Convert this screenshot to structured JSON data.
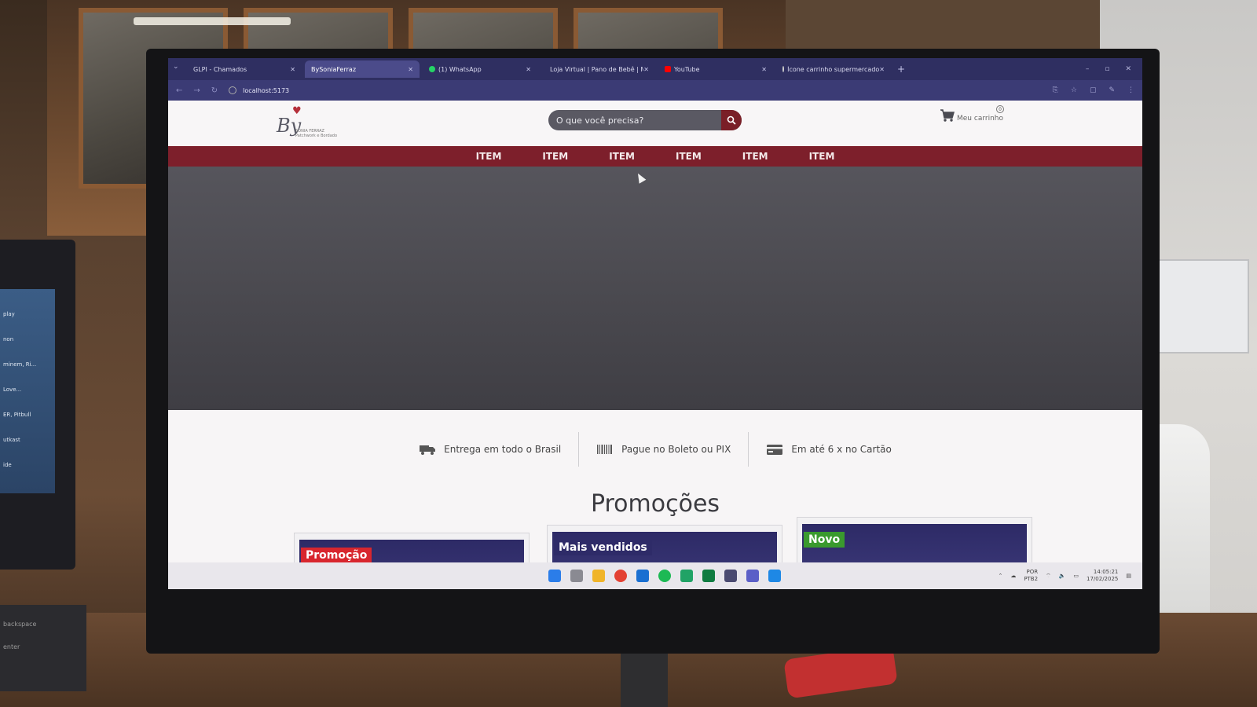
{
  "browser": {
    "tabs": [
      {
        "title": "GLPI - Chamados",
        "icon_color": "#2f2f61",
        "active": false
      },
      {
        "title": "BySoniaFerraz",
        "icon_color": "#4b4b8a",
        "active": true
      },
      {
        "title": "(1) WhatsApp",
        "icon_color": "#25d366",
        "active": false
      },
      {
        "title": "Loja Virtual | Pano de Bebê | M",
        "icon_color": "#1e6fd9",
        "active": false
      },
      {
        "title": "YouTube",
        "icon_color": "#ff0000",
        "active": false
      },
      {
        "title": "Ícone carrinho supermercado",
        "icon_color": "#cccccc",
        "active": false
      }
    ],
    "new_tab": "+",
    "url": "localhost:5173"
  },
  "header": {
    "logo_mark": "By",
    "logo_sub": "SONIA FERRAZ\nPatchwork e Bordado",
    "search_placeholder": "O que você precisa?",
    "cart_label": "Meu carrinho",
    "cart_count": "0"
  },
  "nav": {
    "items": [
      "ITEM",
      "ITEM",
      "ITEM",
      "ITEM",
      "ITEM",
      "ITEM"
    ]
  },
  "benefits": [
    {
      "icon": "truck-icon",
      "text": "Entrega em todo o Brasil"
    },
    {
      "icon": "barcode-icon",
      "text": "Pague no Boleto ou PIX"
    },
    {
      "icon": "credit-card-icon",
      "text": "Em até 6 x no Cartão"
    }
  ],
  "section": {
    "title": "Promoções"
  },
  "cards": [
    {
      "tag": "Promoção",
      "tag_color": "#d8262e"
    },
    {
      "tag": "Mais vendidos",
      "tag_color": "#2e2b68"
    },
    {
      "tag": "Novo",
      "tag_color": "#3a9a2e"
    }
  ],
  "taskbar": {
    "lang_top": "POR",
    "lang_bottom": "PTB2",
    "time": "14:05:21",
    "date": "17/02/2025"
  },
  "laptop": {
    "lines": [
      "play",
      "non",
      "minem, Ri...",
      "Love...",
      "ER, Pitbull",
      "utkast",
      "ide"
    ],
    "keys": [
      "backspace",
      "enter"
    ]
  }
}
